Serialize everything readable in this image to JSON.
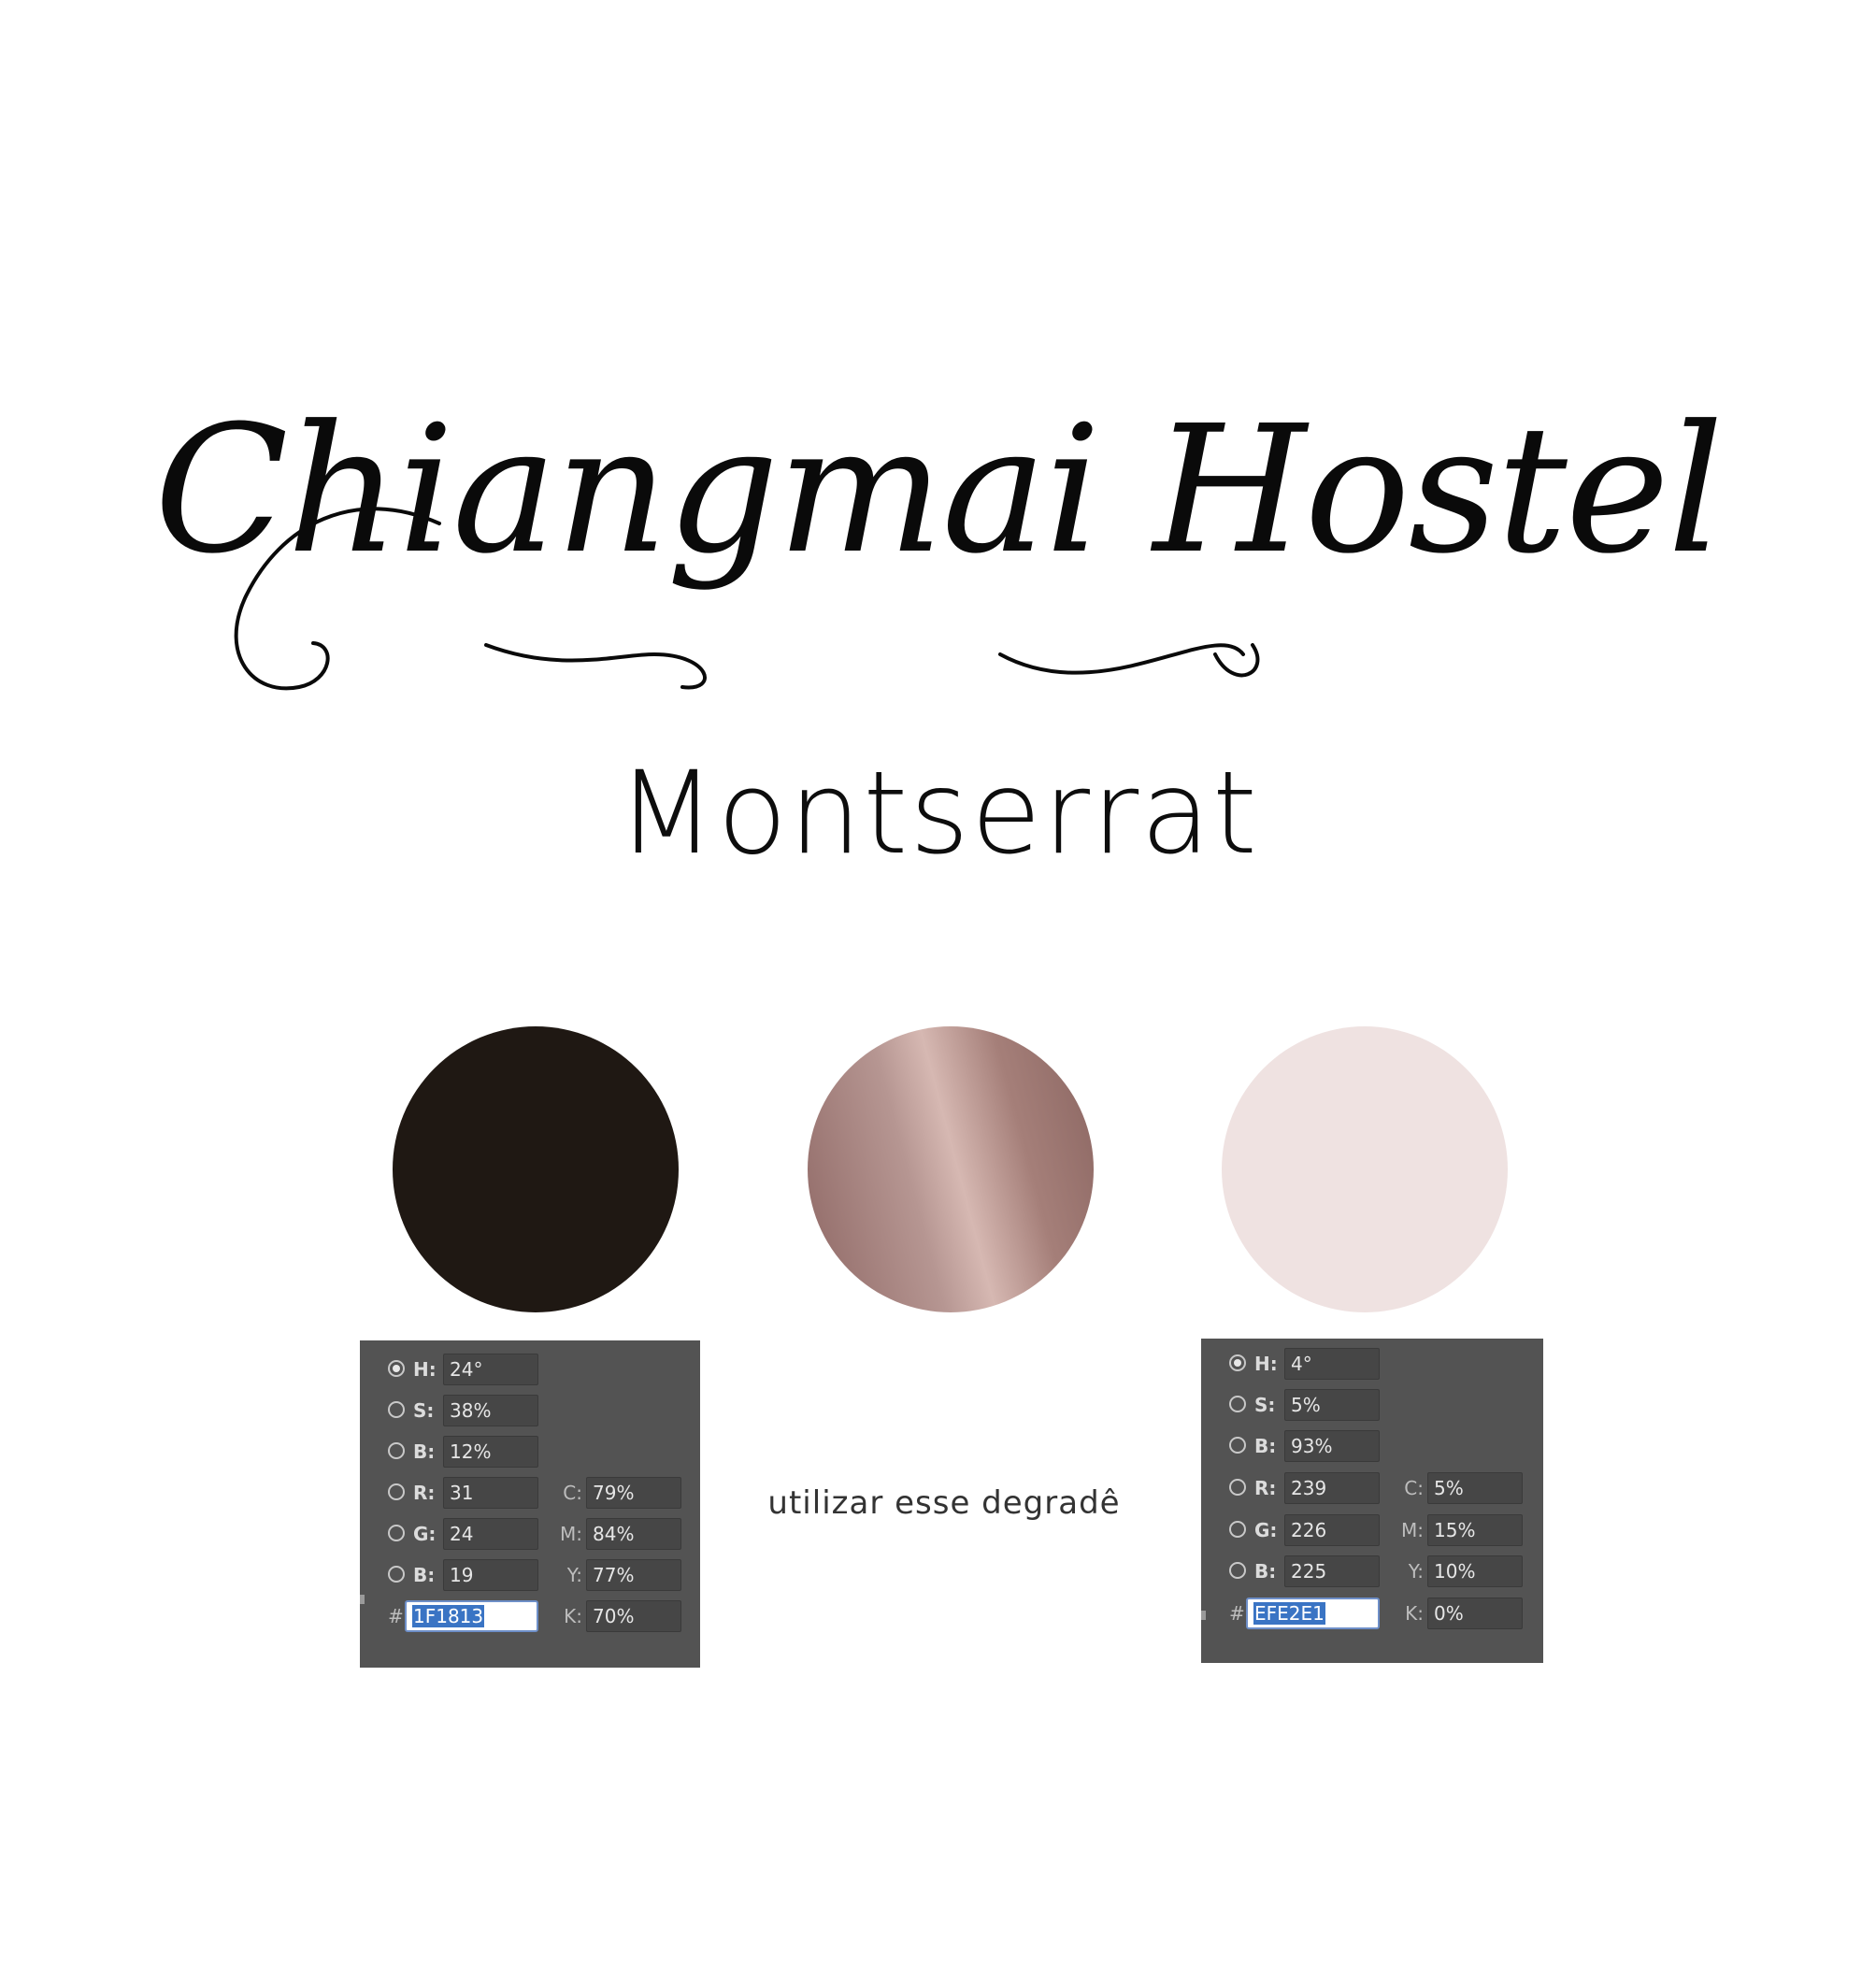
{
  "logo": {
    "title": "Chiangmai Hostel"
  },
  "font": {
    "name": "Montserrat"
  },
  "swatches": {
    "dark": "#1F1813",
    "gradient": [
      "#8E6764",
      "#B69692",
      "#D6B8B2",
      "#A57F79",
      "#8A6561"
    ],
    "light": "#EFE2E1"
  },
  "note": "utilizar esse degradê",
  "pickers": {
    "left": {
      "labels": {
        "h": "H:",
        "s": "S:",
        "b": "B:",
        "r": "R:",
        "g": "G:",
        "b2": "B:",
        "c": "C:",
        "m": "M:",
        "y": "Y:",
        "k": "K:",
        "hash": "#"
      },
      "h": "24°",
      "s": "38%",
      "b": "12%",
      "r": "31",
      "g": "24",
      "b2": "19",
      "c": "79%",
      "m": "84%",
      "y": "77%",
      "k": "70%",
      "hex": "1F1813"
    },
    "right": {
      "labels": {
        "h": "H:",
        "s": "S:",
        "b": "B:",
        "r": "R:",
        "g": "G:",
        "b2": "B:",
        "c": "C:",
        "m": "M:",
        "y": "Y:",
        "k": "K:",
        "hash": "#"
      },
      "h": "4°",
      "s": "5%",
      "b": "93%",
      "r": "239",
      "g": "226",
      "b2": "225",
      "c": "5%",
      "m": "15%",
      "y": "10%",
      "k": "0%",
      "hex": "EFE2E1"
    }
  }
}
